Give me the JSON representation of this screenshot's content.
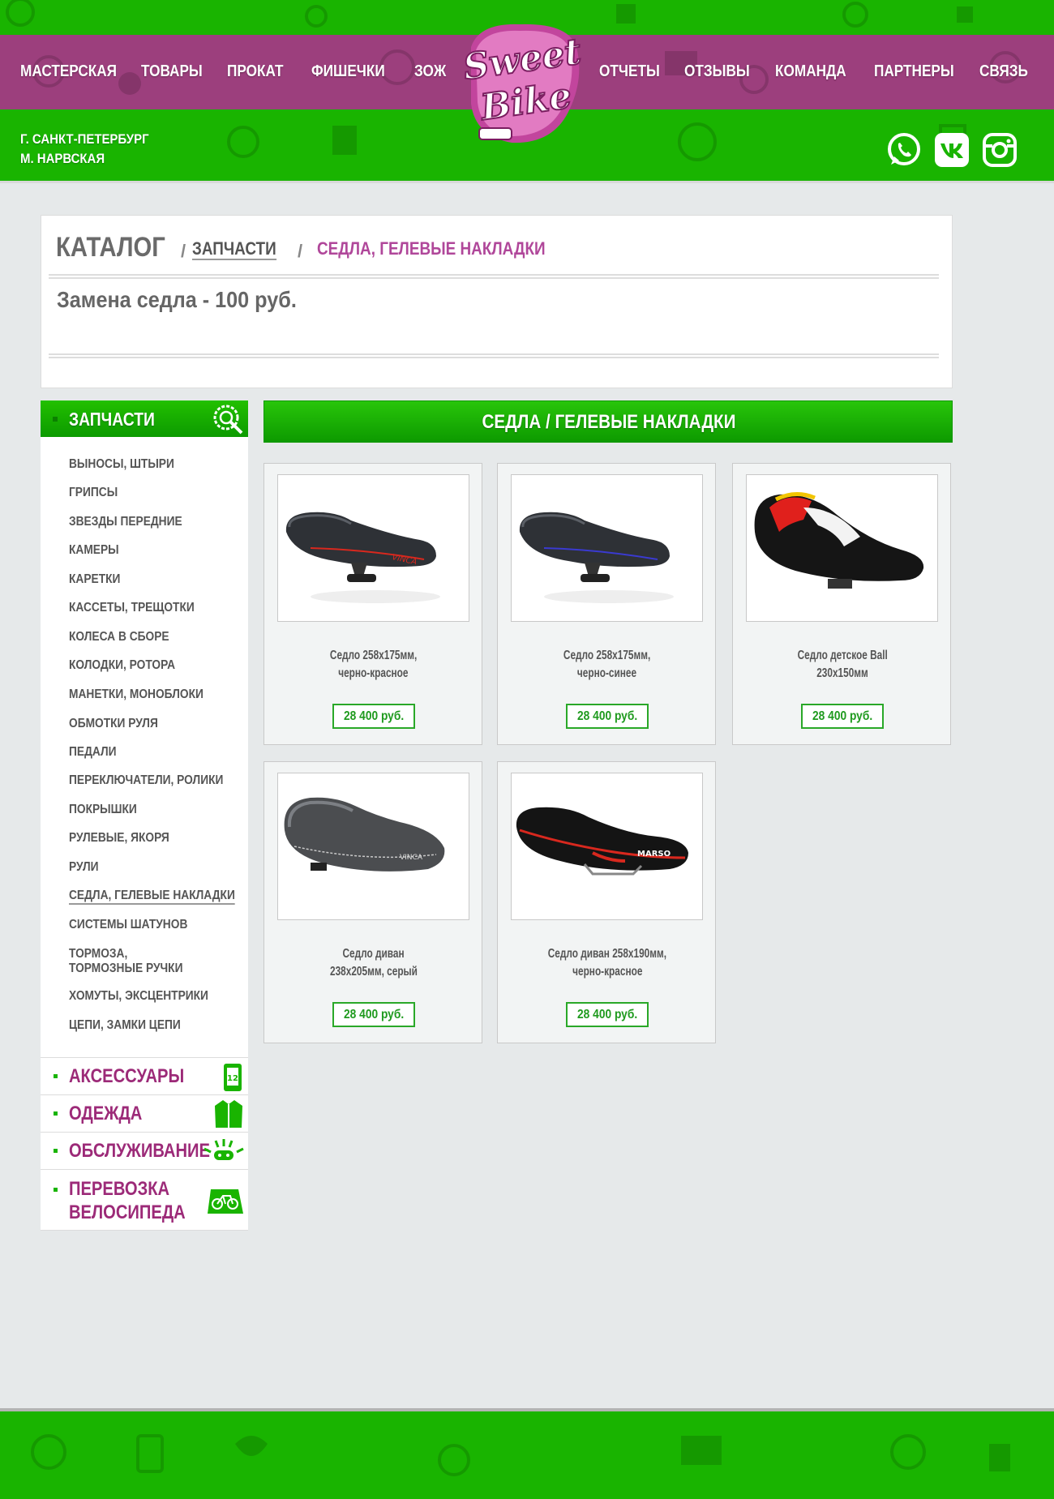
{
  "brand": {
    "logo_line1": "Sweet",
    "logo_line2": "Bike"
  },
  "nav": {
    "left": [
      "МАСТЕРСКАЯ",
      "ТОВАРЫ",
      "ПРОКАТ",
      "ФИШЕЧКИ",
      "ЗОЖ"
    ],
    "right": [
      "ОТЧЕТЫ",
      "ОТЗЫВЫ",
      "КОМАНДА",
      "ПАРТНЕРЫ",
      "СВЯЗЬ"
    ]
  },
  "location": {
    "city": "Г. САНКТ-ПЕТЕРБУРГ",
    "metro": "М. НАРВСКАЯ"
  },
  "social": [
    "whatsapp-icon",
    "vk-icon",
    "instagram-icon"
  ],
  "catalog": {
    "title": "КАТАЛОГ",
    "separator": "/",
    "crumb_parent": "ЗАПЧАСТИ",
    "crumb_current": "СЕДЛА, ГЕЛЕВЫЕ НАКЛАДКИ",
    "note": "Замена седла - 100 руб."
  },
  "sidebar": {
    "title": "ЗАПЧАСТИ",
    "items": [
      "ВЫНОСЫ, ШТЫРИ",
      "ГРИПСЫ",
      "ЗВЕЗДЫ ПЕРЕДНИЕ",
      "КАМЕРЫ",
      "КАРЕТКИ",
      "КАССЕТЫ, ТРЕЩОТКИ",
      "КОЛЕСА В СБОРЕ",
      "КОЛОДКИ, РОТОРА",
      "МАНЕТКИ, МОНОБЛОКИ",
      "ОБМОТКИ РУЛЯ",
      "ПЕДАЛИ",
      "ПЕРЕКЛЮЧАТЕЛИ, РОЛИКИ",
      "ПОКРЫШКИ",
      "РУЛЕВЫЕ, ЯКОРЯ",
      "РУЛИ",
      "СЕДЛА, ГЕЛЕВЫЕ НАКЛАДКИ",
      "СИСТЕМЫ ШАТУНОВ",
      "ТОРМОЗА,",
      "ТОРМОЗНЫЕ РУЧКИ",
      "ХОМУТЫ, ЭКСЦЕНТРИКИ",
      "ЦЕПИ, ЗАМКИ ЦЕПИ"
    ],
    "active_index": 15,
    "categories": [
      {
        "label": "АКСЕССУАРЫ",
        "icon": "phone-icon"
      },
      {
        "label": "ОДЕЖДА",
        "icon": "jacket-icon"
      },
      {
        "label": "ОБСЛУЖИВАНИЕ",
        "icon": "bike-light-icon"
      },
      {
        "label_line1": "ПЕРЕВОЗКА",
        "label_line2": "ВЕЛОСИПЕДА",
        "icon": "bike-bag-icon"
      }
    ]
  },
  "products": {
    "title": "СЕДЛА / ГЕЛЕВЫЕ НАКЛАДКИ",
    "items": [
      {
        "name1": "Седло 258х175мм,",
        "name2": "черно-красное",
        "price": "28 400 руб.",
        "brand": "VINCA",
        "accent": "#d8281e"
      },
      {
        "name1": "Седло 258х175мм,",
        "name2": "черно-синее",
        "price": "28 400 руб.",
        "brand": "",
        "accent": "#3a3ad0"
      },
      {
        "name1": "Седло детское Ball",
        "name2": "230х150мм",
        "price": "28 400 руб.",
        "brand": "",
        "accent": "#e0201c"
      },
      {
        "name1": "Седло диван",
        "name2": "238х205мм, серый",
        "price": "28 400 руб.",
        "brand": "VINCA",
        "accent": "#5a5a5a"
      },
      {
        "name1": "Седло диван 258х190мм,",
        "name2": "черно-красное",
        "price": "28 400 руб.",
        "brand": "MARSO",
        "accent": "#d8281e"
      }
    ]
  },
  "colors": {
    "green": "#19b400",
    "purple": "#9c3f7d",
    "pink": "#b0479a",
    "price_green": "#1f9a1e"
  }
}
